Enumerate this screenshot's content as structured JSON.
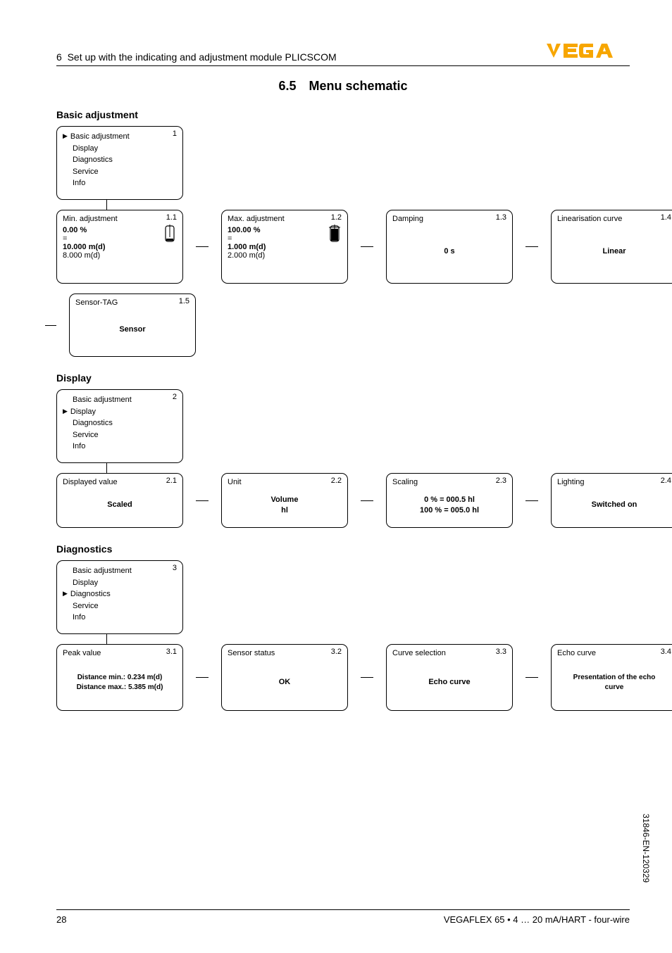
{
  "header": {
    "chapter": "6",
    "chapter_title": "Set up with the indicating and adjustment module PLICSCOM",
    "logo_text": "VEGA"
  },
  "section_title": "6.5 Menu schematic",
  "groups": {
    "basic_adjustment": {
      "heading": "Basic adjustment",
      "root": {
        "num": "1",
        "items": [
          "Basic adjustment",
          "Display",
          "Diagnostics",
          "Service",
          "Info"
        ],
        "active_index": 0
      },
      "row1": [
        {
          "num": "1.1",
          "title": "Min. adjustment",
          "lines": [
            "0.00 %",
            "=",
            "10.000 m(d)"
          ],
          "bold_lines": [
            0,
            2
          ],
          "footer": "8.000 m(d)",
          "icon": "tank-empty"
        },
        {
          "num": "1.2",
          "title": "Max. adjustment",
          "lines": [
            "100.00 %",
            "=",
            "1.000 m(d)"
          ],
          "bold_lines": [
            0,
            2
          ],
          "footer": "2.000 m(d)",
          "icon": "tank-full"
        },
        {
          "num": "1.3",
          "title": "Damping",
          "center": "0 s"
        },
        {
          "num": "1.4",
          "title": "Linearisation curve",
          "center": "Linear"
        }
      ],
      "row2": [
        {
          "num": "1.5",
          "title": "Sensor-TAG",
          "center": "Sensor"
        }
      ]
    },
    "display": {
      "heading": "Display",
      "root": {
        "num": "2",
        "items": [
          "Basic adjustment",
          "Display",
          "Diagnostics",
          "Service",
          "Info"
        ],
        "active_index": 1
      },
      "row1": [
        {
          "num": "2.1",
          "title": "Displayed value",
          "center": "Scaled"
        },
        {
          "num": "2.2",
          "title": "Unit",
          "center_lines": [
            "Volume",
            "hl"
          ]
        },
        {
          "num": "2.3",
          "title": "Scaling",
          "center_lines": [
            "0 % = 000.5 hl",
            "100 % = 005.0 hl"
          ]
        },
        {
          "num": "2.4",
          "title": "Lighting",
          "center": "Switched on"
        }
      ]
    },
    "diagnostics": {
      "heading": "Diagnostics",
      "root": {
        "num": "3",
        "items": [
          "Basic adjustment",
          "Display",
          "Diagnostics",
          "Service",
          "Info"
        ],
        "active_index": 2
      },
      "row1": [
        {
          "num": "3.1",
          "title": "Peak value",
          "center_lines": [
            "Distance min.: 0.234 m(d)",
            "Distance max.: 5.385 m(d)"
          ]
        },
        {
          "num": "3.2",
          "title": "Sensor status",
          "center": "OK"
        },
        {
          "num": "3.3",
          "title": "Curve selection",
          "center": "Echo curve"
        },
        {
          "num": "3.4",
          "title": "Echo curve",
          "center_lines": [
            "Presentation of the echo",
            "curve"
          ]
        }
      ]
    }
  },
  "footer": {
    "page": "28",
    "product": "VEGAFLEX 65 • 4 … 20 mA/HART - four-wire"
  },
  "side_code": "31846-EN-120329"
}
